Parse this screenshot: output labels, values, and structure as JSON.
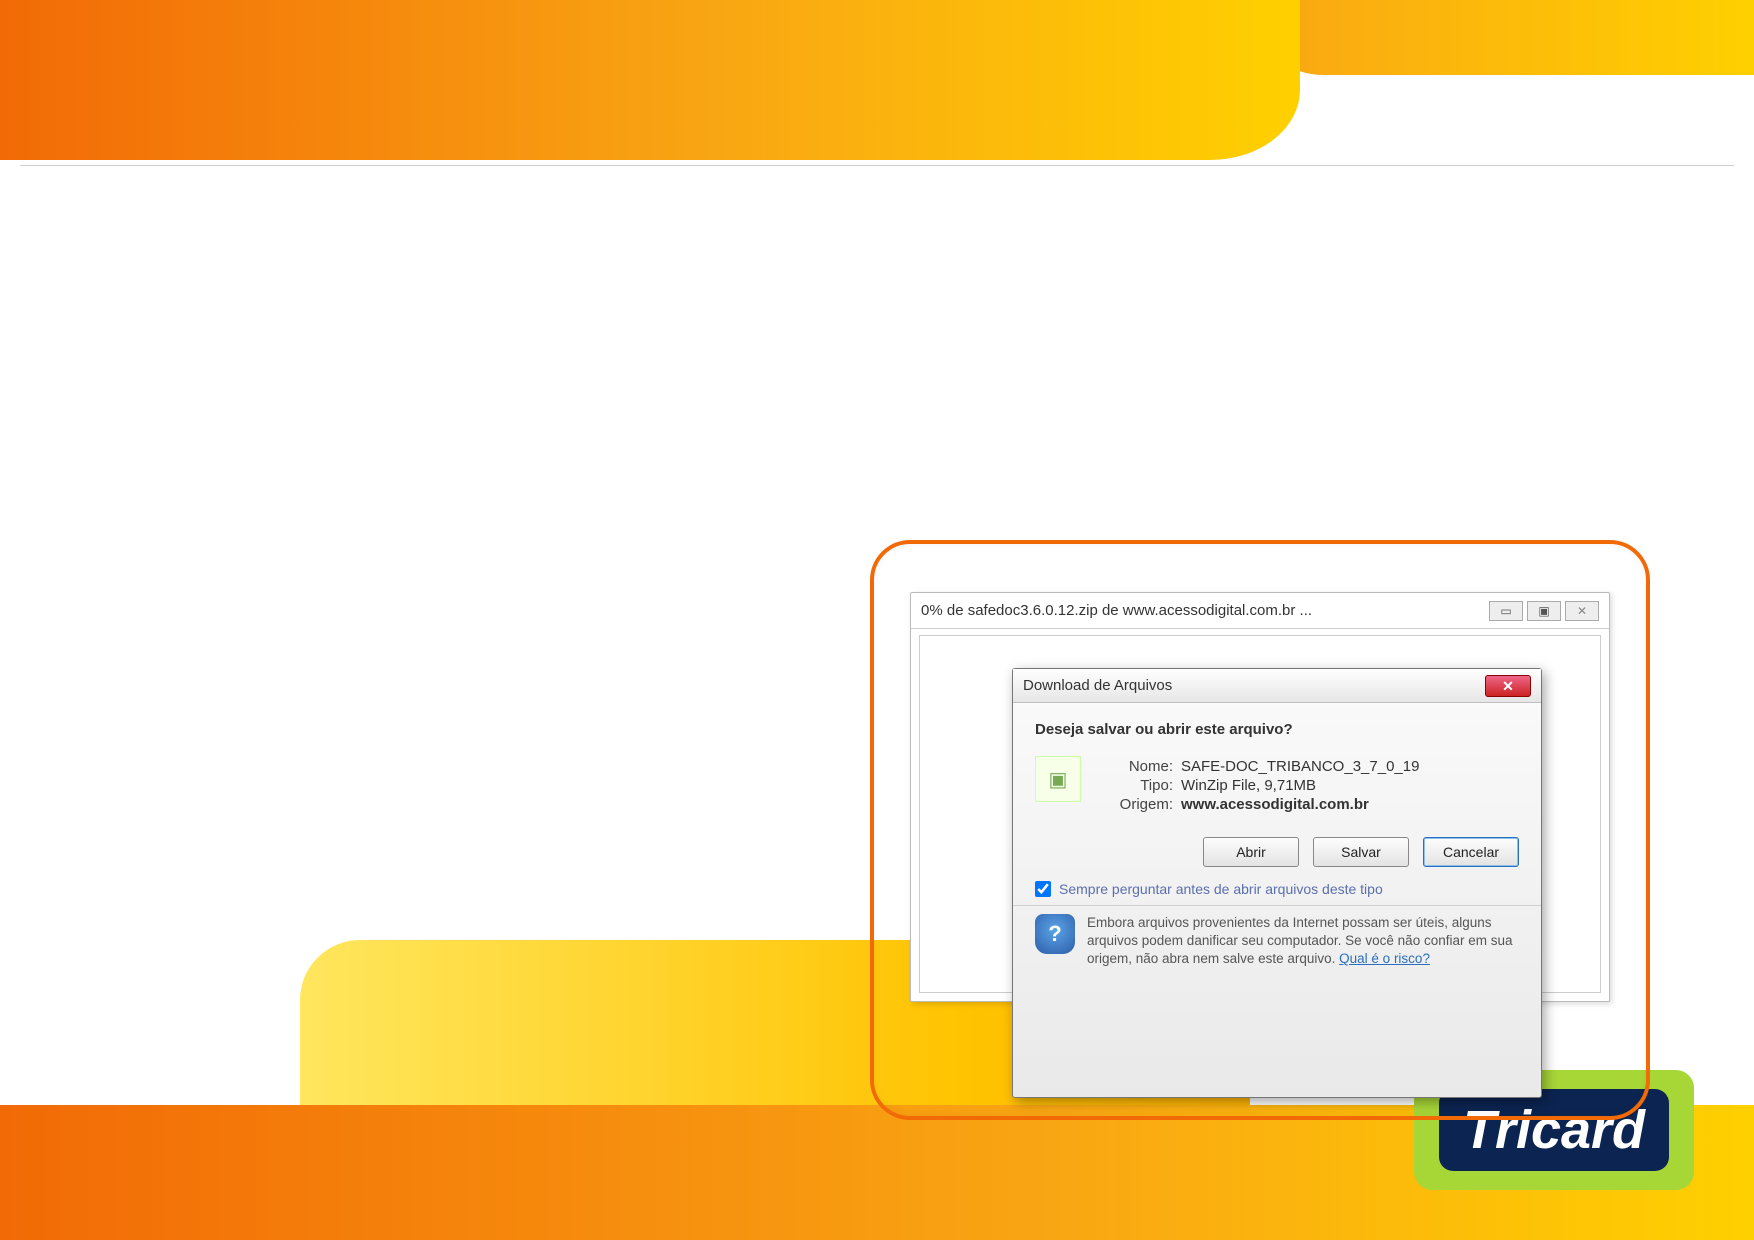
{
  "logo": {
    "text": "Tricard"
  },
  "backWindow": {
    "title": "0% de safedoc3.6.0.12.zip de www.acessodigital.com.br ...",
    "min": "▭",
    "max": "▣",
    "close": "✕"
  },
  "dialog": {
    "title": "Download de Arquivos",
    "question": "Deseja salvar ou abrir este arquivo?",
    "labels": {
      "name": "Nome:",
      "type": "Tipo:",
      "origin": "Origem:"
    },
    "values": {
      "name": "SAFE-DOC_TRIBANCO_3_7_0_19",
      "type": "WinZip File, 9,71MB",
      "origin": "www.acessodigital.com.br"
    },
    "buttons": {
      "open": "Abrir",
      "save": "Salvar",
      "cancel": "Cancelar"
    },
    "checkbox": "Sempre perguntar antes de abrir arquivos deste tipo",
    "warning": "Embora arquivos provenientes da Internet possam ser úteis, alguns arquivos podem danificar seu computador. Se você não confiar em sua origem, não abra nem salve este arquivo.",
    "riskLink": "Qual é o risco?"
  }
}
